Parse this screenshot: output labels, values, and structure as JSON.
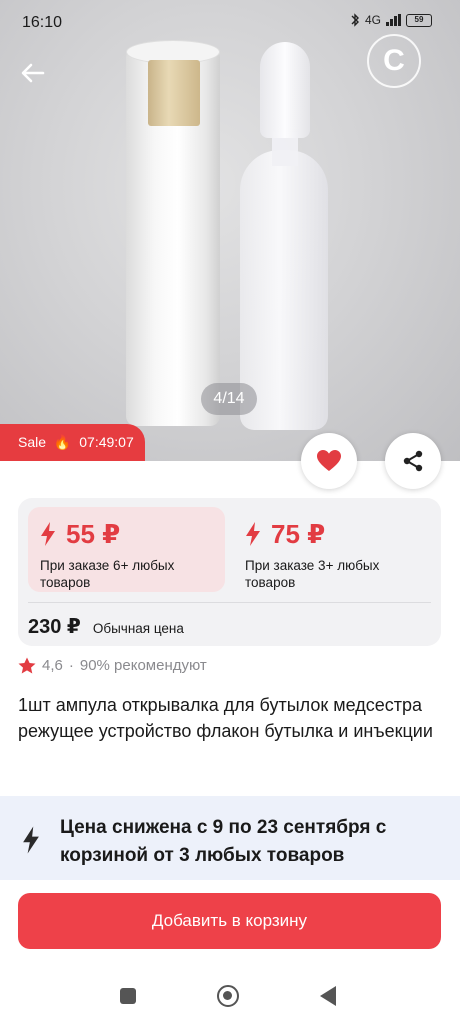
{
  "status_bar": {
    "time": "16:10",
    "network": "4G",
    "battery": "59"
  },
  "gallery": {
    "counter": "4/14",
    "brand_letter": "C"
  },
  "sale": {
    "label": "Sale",
    "emoji": "🔥",
    "timer": "07:49:07"
  },
  "price_tiers": [
    {
      "price": "55 ₽",
      "note": "При заказе 6+ любых товаров"
    },
    {
      "price": "75 ₽",
      "note": "При заказе 3+ любых товаров"
    }
  ],
  "regular": {
    "price": "230 ₽",
    "label": "Обычная цена"
  },
  "rating": {
    "value": "4,6",
    "separator": "·",
    "recommend": "90% рекомендуют"
  },
  "product_title": "1шт ампула открывалка для бутылок медсестра режущее устройство флакон бутылка и инъекции",
  "promo": {
    "text": "Цена снижена с 9 по 23 сентября с корзиной от 3 любых товаров"
  },
  "cart_button": {
    "label": "Добавить в корзину"
  },
  "colors": {
    "accent": "#ee4149",
    "price_red": "#e23c42",
    "promo_bg": "#edf1fa",
    "tier_bg": "#f7e2e4"
  },
  "icons": [
    "back-arrow-icon",
    "favorite-heart-icon",
    "share-icon",
    "lightning-icon",
    "star-icon"
  ]
}
